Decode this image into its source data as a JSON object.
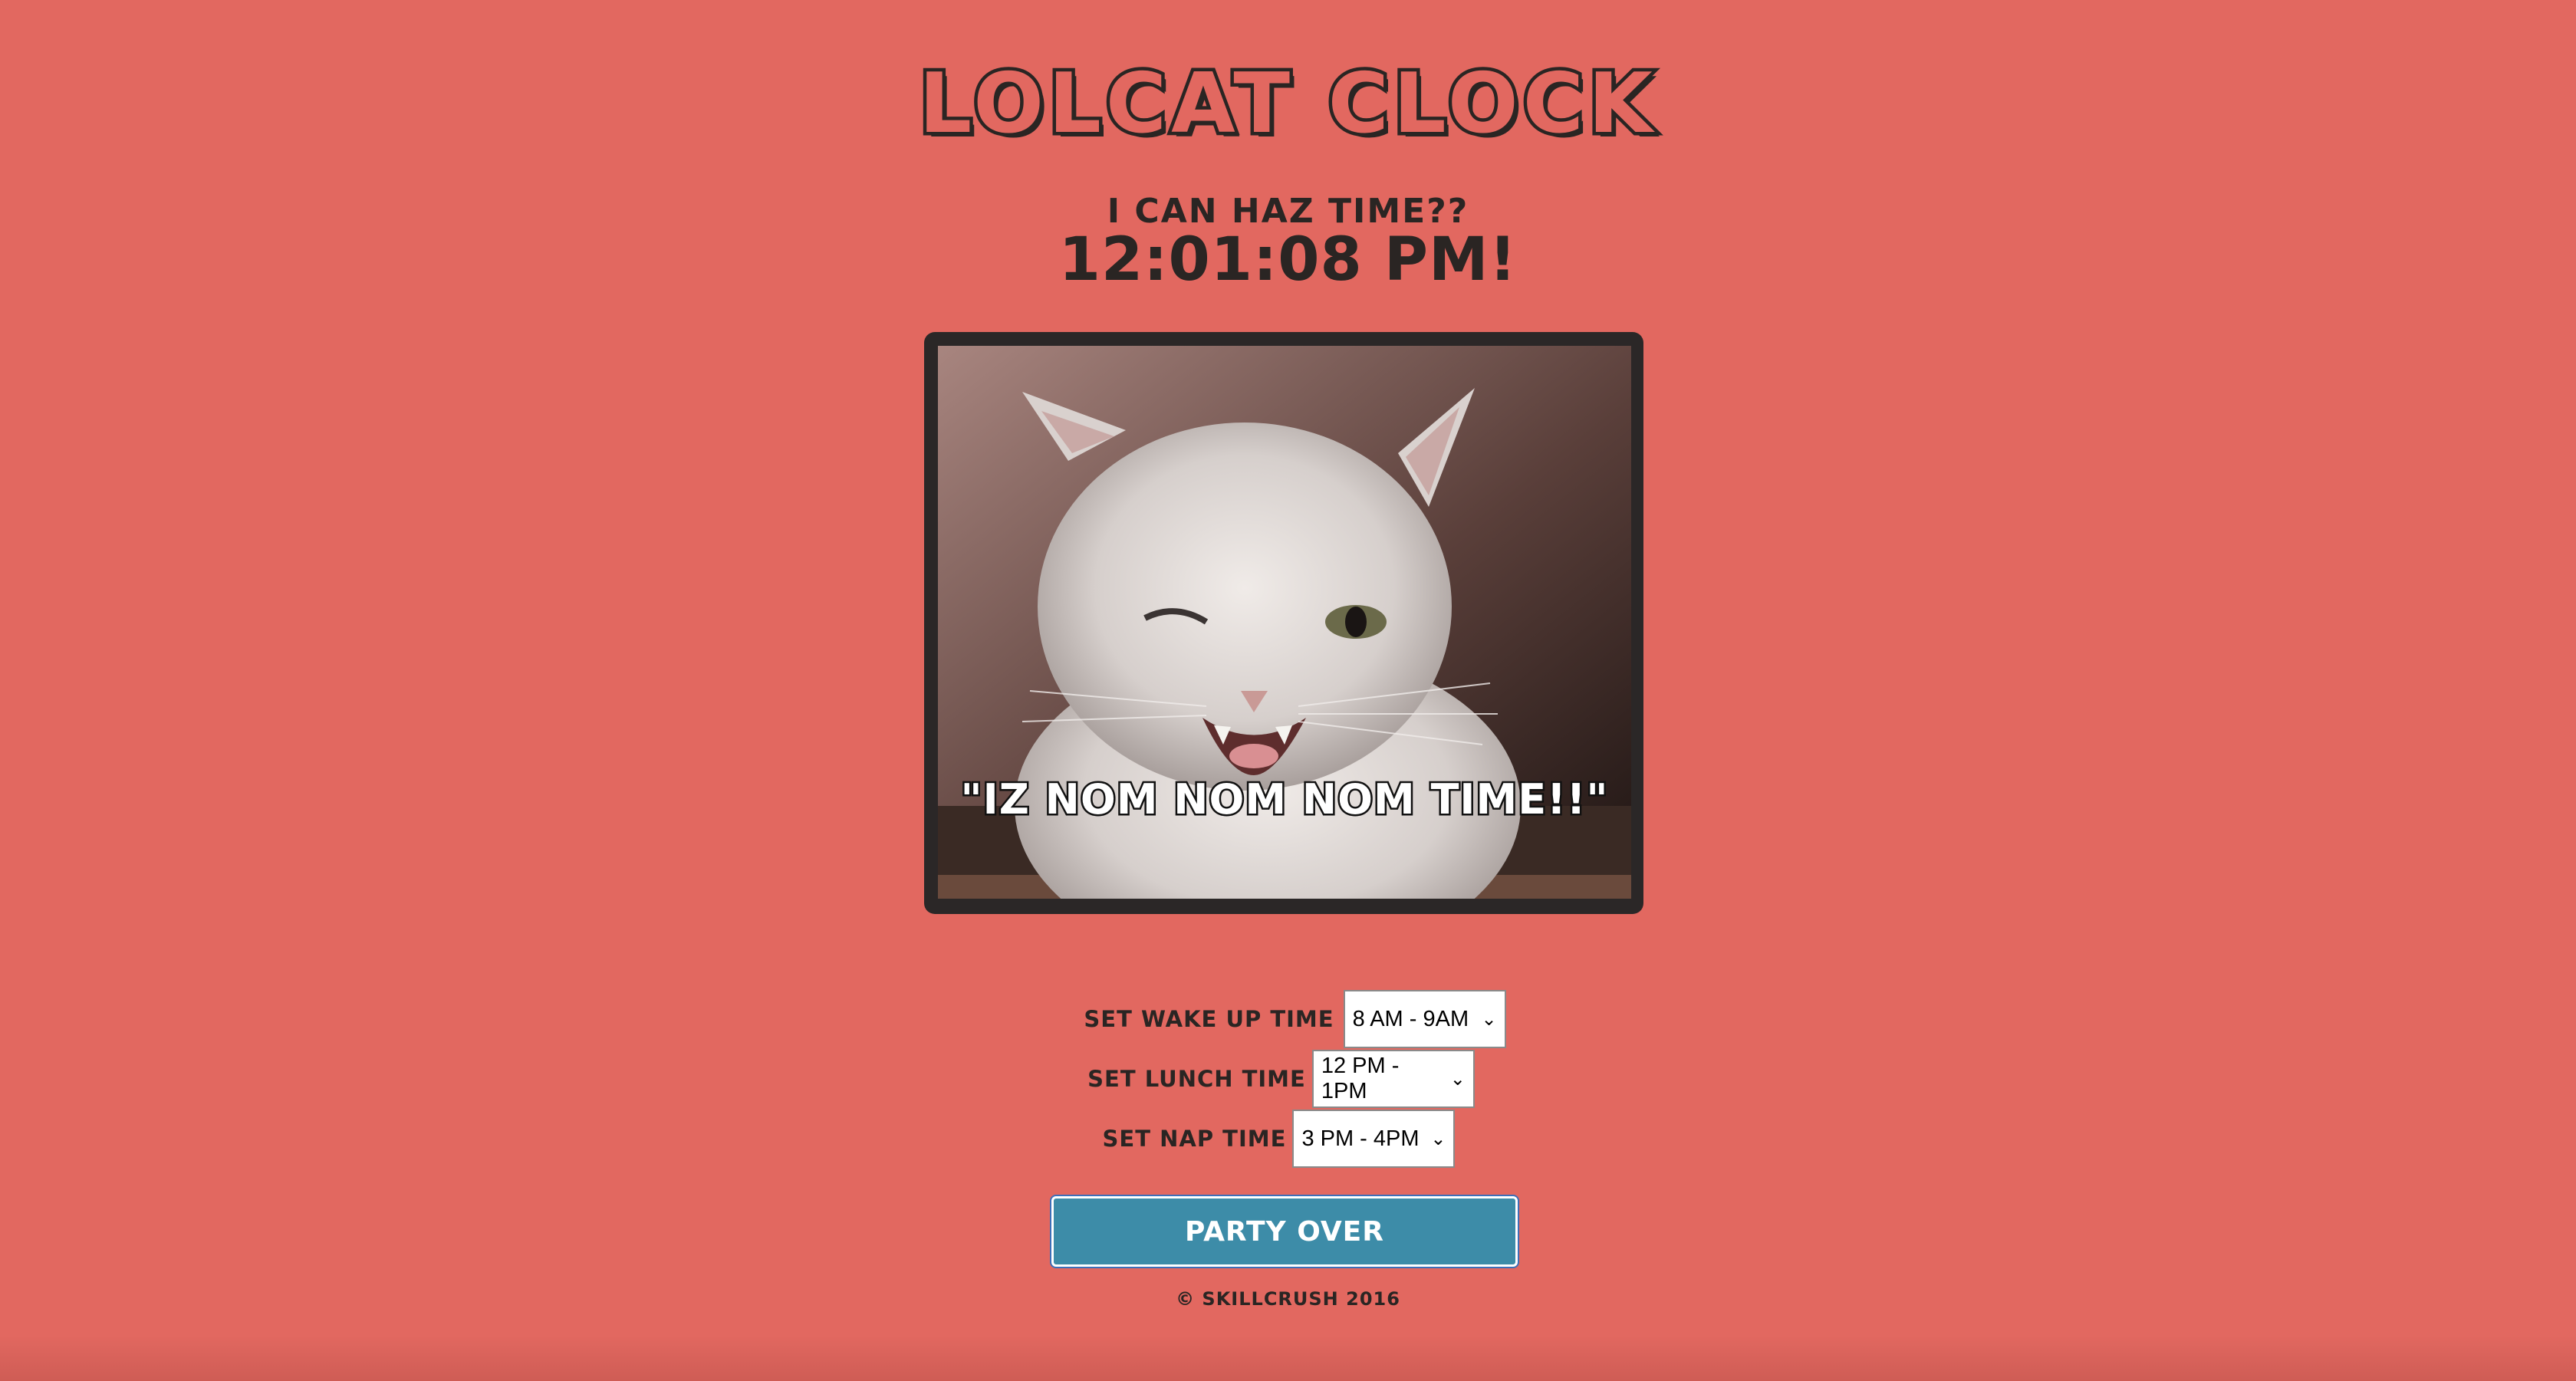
{
  "header": {
    "title": "LOLCAT CLOCK",
    "subtitle": "I CAN HAZ TIME??",
    "time": "12:01:08 PM!"
  },
  "image": {
    "caption": "\"IZ NOM NOM NOM TIME!!\""
  },
  "settings": {
    "wake": {
      "label": "SET WAKE UP TIME",
      "selected": "8 AM - 9AM"
    },
    "lunch": {
      "label": "SET LUNCH TIME",
      "selected": "12 PM - 1PM"
    },
    "nap": {
      "label": "SET NAP TIME",
      "selected": "3 PM - 4PM"
    }
  },
  "button": {
    "label": "PARTY OVER"
  },
  "footer": {
    "text": "© SKILLCRUSH 2016"
  },
  "colors": {
    "background": "#e26860",
    "text": "#2a2523",
    "button": "#3d8ca8",
    "frame": "#2b2727"
  }
}
